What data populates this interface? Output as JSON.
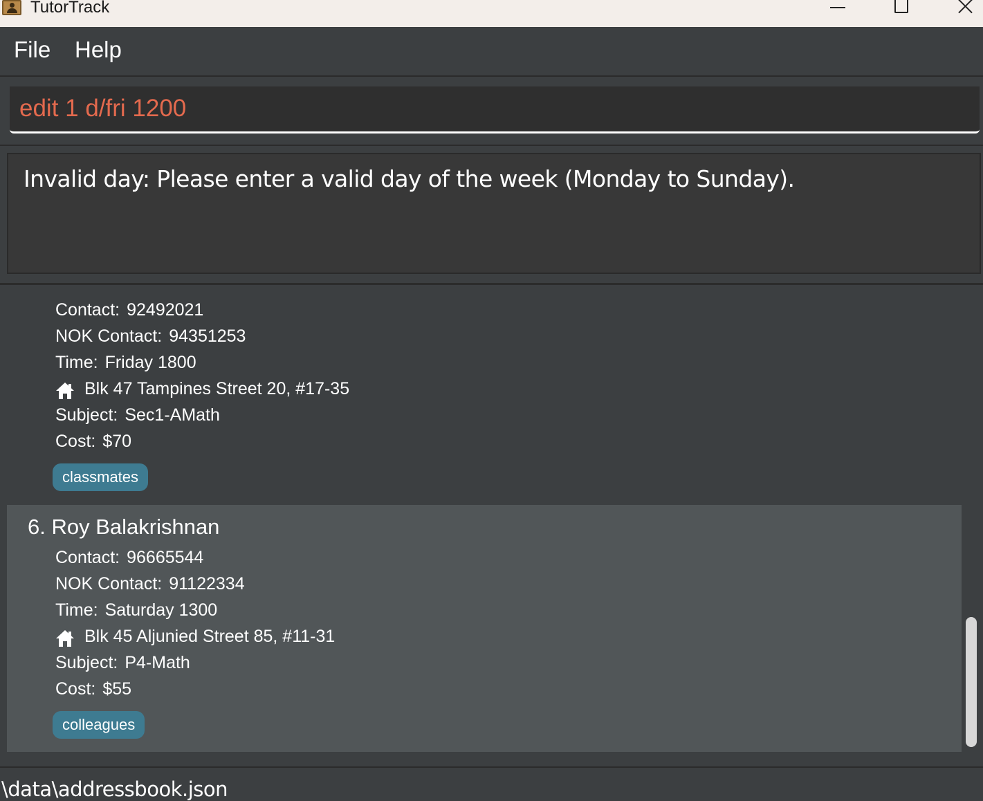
{
  "window": {
    "title": "TutorTrack"
  },
  "menu": {
    "file": "File",
    "help": "Help"
  },
  "command": {
    "value": "edit 1 d/fri 1200"
  },
  "result": {
    "message": "Invalid day: Please enter a valid day of the week (Monday to Sunday)."
  },
  "persons": [
    {
      "contact_label": "Contact:",
      "contact": "92492021",
      "nok_label": "NOK Contact:",
      "nok": "94351253",
      "time_label": "Time:",
      "time": "Friday 1800",
      "address_icon": "home-icon",
      "address": "Blk 47 Tampines Street 20, #17-35",
      "subject_label": "Subject:",
      "subject": "Sec1-AMath",
      "cost_label": "Cost:",
      "cost": "$70",
      "tag": "classmates"
    },
    {
      "name": "6. Roy Balakrishnan",
      "contact_label": "Contact:",
      "contact": "96665544",
      "nok_label": "NOK Contact:",
      "nok": "91122334",
      "time_label": "Time:",
      "time": "Saturday 1300",
      "address_icon": "home-icon",
      "address": "Blk 45 Aljunied Street 85, #11-31",
      "subject_label": "Subject:",
      "subject": "P4-Math",
      "cost_label": "Cost:",
      "cost": "$55",
      "tag": "colleagues"
    }
  ],
  "status": {
    "path": "\\data\\addressbook.json"
  },
  "colors": {
    "command_text": "#e46a4e",
    "tag_bg": "#3e7b91",
    "selected_card": "#515658",
    "background": "#3c3f41"
  }
}
